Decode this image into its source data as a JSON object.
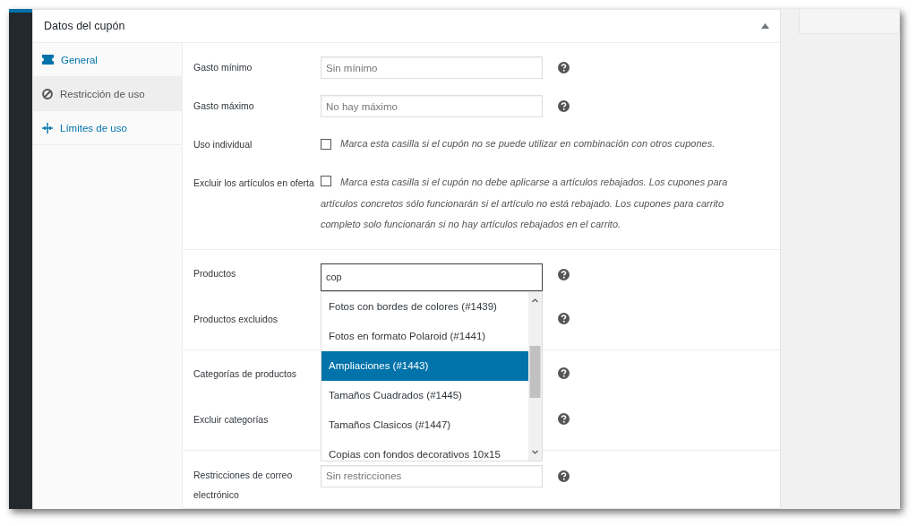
{
  "panel": {
    "title": "Datos del cupón",
    "expanded": true
  },
  "tabs": [
    {
      "label": "General",
      "selected": false
    },
    {
      "label": "Restricción de uso",
      "selected": true
    },
    {
      "label": "Límites de uso",
      "selected": false
    }
  ],
  "sections": [
    {
      "fields": [
        {
          "kind": "input",
          "label": "Gasto mínimo",
          "placeholder": "Sin mínimo"
        },
        {
          "kind": "input",
          "label": "Gasto máximo",
          "placeholder": "No hay máximo"
        },
        {
          "kind": "checkbox",
          "label": "Uso individual",
          "checked": false,
          "description": "Marca esta casilla si el cupón no se puede utilizar en combinación con otros cupones."
        },
        {
          "kind": "checkbox",
          "label": "Excluir los artículos en oferta",
          "checked": false,
          "description": "Marca esta casilla si el cupón no debe aplicarse a artículos rebajados. Los cupones para artículos concretos sólo funcionarán si el artículo no está rebajado. Los cupones para carrito completo solo funcionarán si no hay artículos rebajados en el carrito."
        }
      ]
    },
    {
      "fields": [
        {
          "kind": "search",
          "label": "Productos",
          "value": "cop",
          "dropdown": [
            {
              "label": "Fotos con bordes de colores (#1439)",
              "selected": false
            },
            {
              "label": "Fotos en formato Polaroid (#1441)",
              "selected": false
            },
            {
              "label": "Ampliaciones (#1443)",
              "selected": true
            },
            {
              "label": "Tamaños Cuadrados (#1445)",
              "selected": false
            },
            {
              "label": "Tamaños Clasicos (#1447)",
              "selected": false
            },
            {
              "label": "Copias con fondos decorativos 10x15",
              "selected": false
            }
          ]
        },
        {
          "kind": "covered",
          "label": "Productos excluidos"
        }
      ]
    },
    {
      "fields": [
        {
          "kind": "covered",
          "label": "Categorías de productos"
        },
        {
          "kind": "covered",
          "label": "Excluir categorías"
        }
      ]
    },
    {
      "fields": [
        {
          "kind": "input",
          "label": "Restricciones de correo electrónico",
          "placeholder": "Sin restricciones"
        }
      ]
    }
  ]
}
